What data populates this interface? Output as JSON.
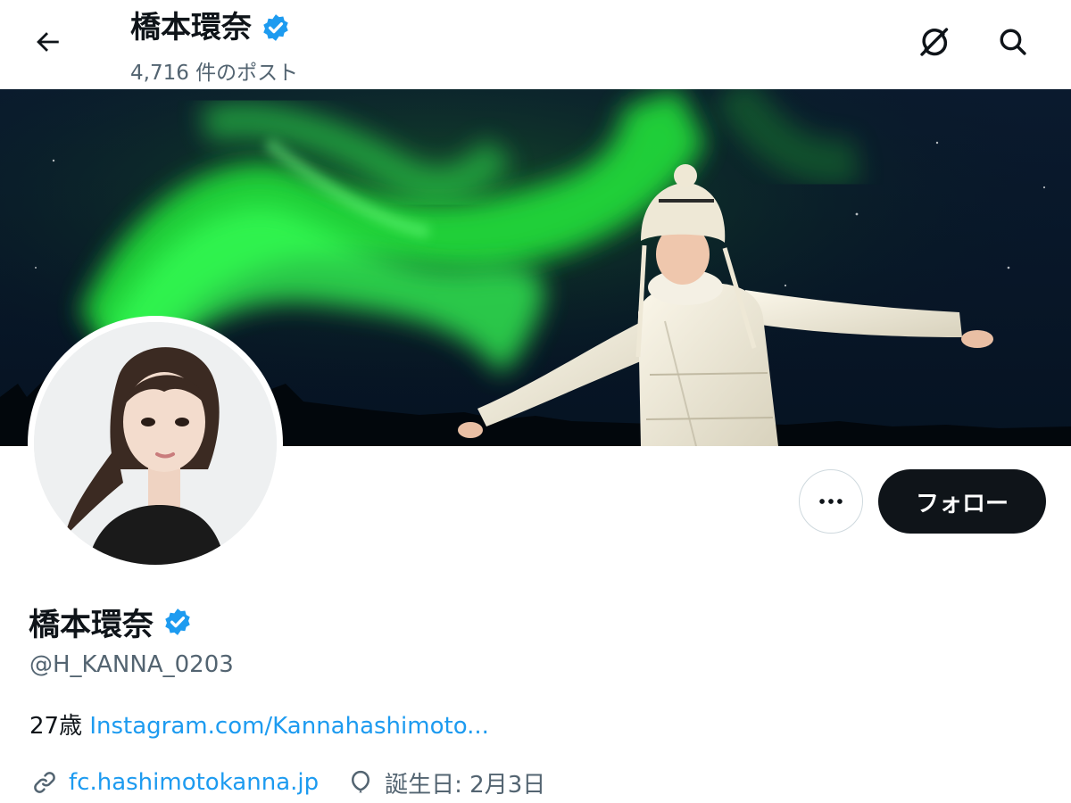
{
  "header": {
    "name": "橋本環奈",
    "post_count": "4,716 件のポスト",
    "icons": {
      "back": "back-arrow-icon",
      "grok": "grok-icon",
      "search": "search-icon"
    }
  },
  "actions": {
    "more_icon": "more-dots-icon",
    "follow_label": "フォロー"
  },
  "profile": {
    "name": "橋本環奈",
    "handle": "@H_KANNA_0203",
    "bio_prefix": "27歳 ",
    "bio_link": "Instagram.com/Kannahashimoto...",
    "website": "fc.hashimotokanna.jp",
    "birthday": "誕生日: 2月3日",
    "icons": {
      "verified": "verified-badge-icon",
      "link": "link-icon",
      "birthday": "balloon-icon"
    }
  },
  "colors": {
    "accent": "#1d9bf0",
    "text_primary": "#0f1419",
    "text_secondary": "#536471",
    "follow_bg": "#0f1419",
    "aurora": "#22e03a"
  }
}
